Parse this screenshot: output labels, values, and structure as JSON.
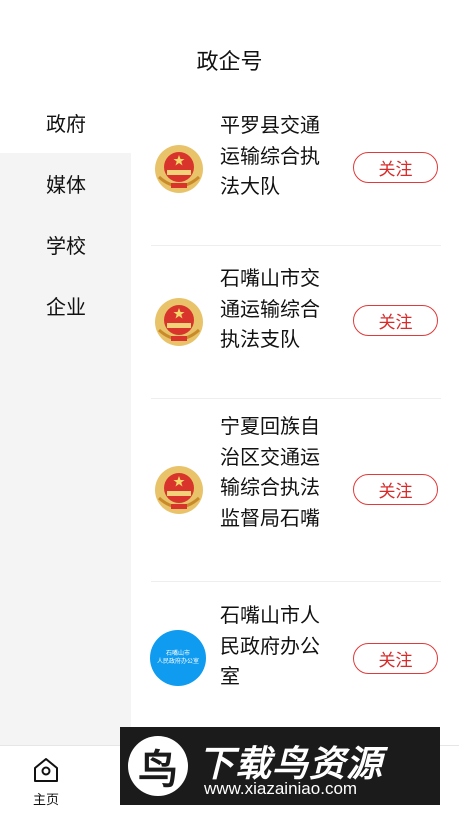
{
  "header": {
    "title": "政企号"
  },
  "sidebar": {
    "items": [
      {
        "label": "政府",
        "active": true
      },
      {
        "label": "媒体",
        "active": false
      },
      {
        "label": "学校",
        "active": false
      },
      {
        "label": "企业",
        "active": false
      }
    ]
  },
  "list": {
    "items": [
      {
        "name": "平罗县交通运输综合执法大队",
        "follow": "关注",
        "avatar": "national-emblem-icon"
      },
      {
        "name": "石嘴山市交通运输综合执法支队",
        "follow": "关注",
        "avatar": "national-emblem-icon"
      },
      {
        "name": "宁夏回族自治区交通运输综合执法监督局石嘴",
        "follow": "关注",
        "avatar": "national-emblem-icon"
      },
      {
        "name": "石嘴山市人民政府办公室",
        "follow": "关注",
        "avatar": "org-logo",
        "avatar_line1": "石嘴山市",
        "avatar_line2": "人民政府办公室"
      }
    ]
  },
  "tabbar": {
    "home_label": "主页"
  },
  "watermark": {
    "logo_glyph": "鸟",
    "title": "下载鸟资源",
    "url": "www.xiazainiao.com"
  },
  "colors": {
    "accent": "#d92a2a",
    "sidebar_bg": "#f4f4f4",
    "avatar_blue": "#0e9bf0"
  }
}
